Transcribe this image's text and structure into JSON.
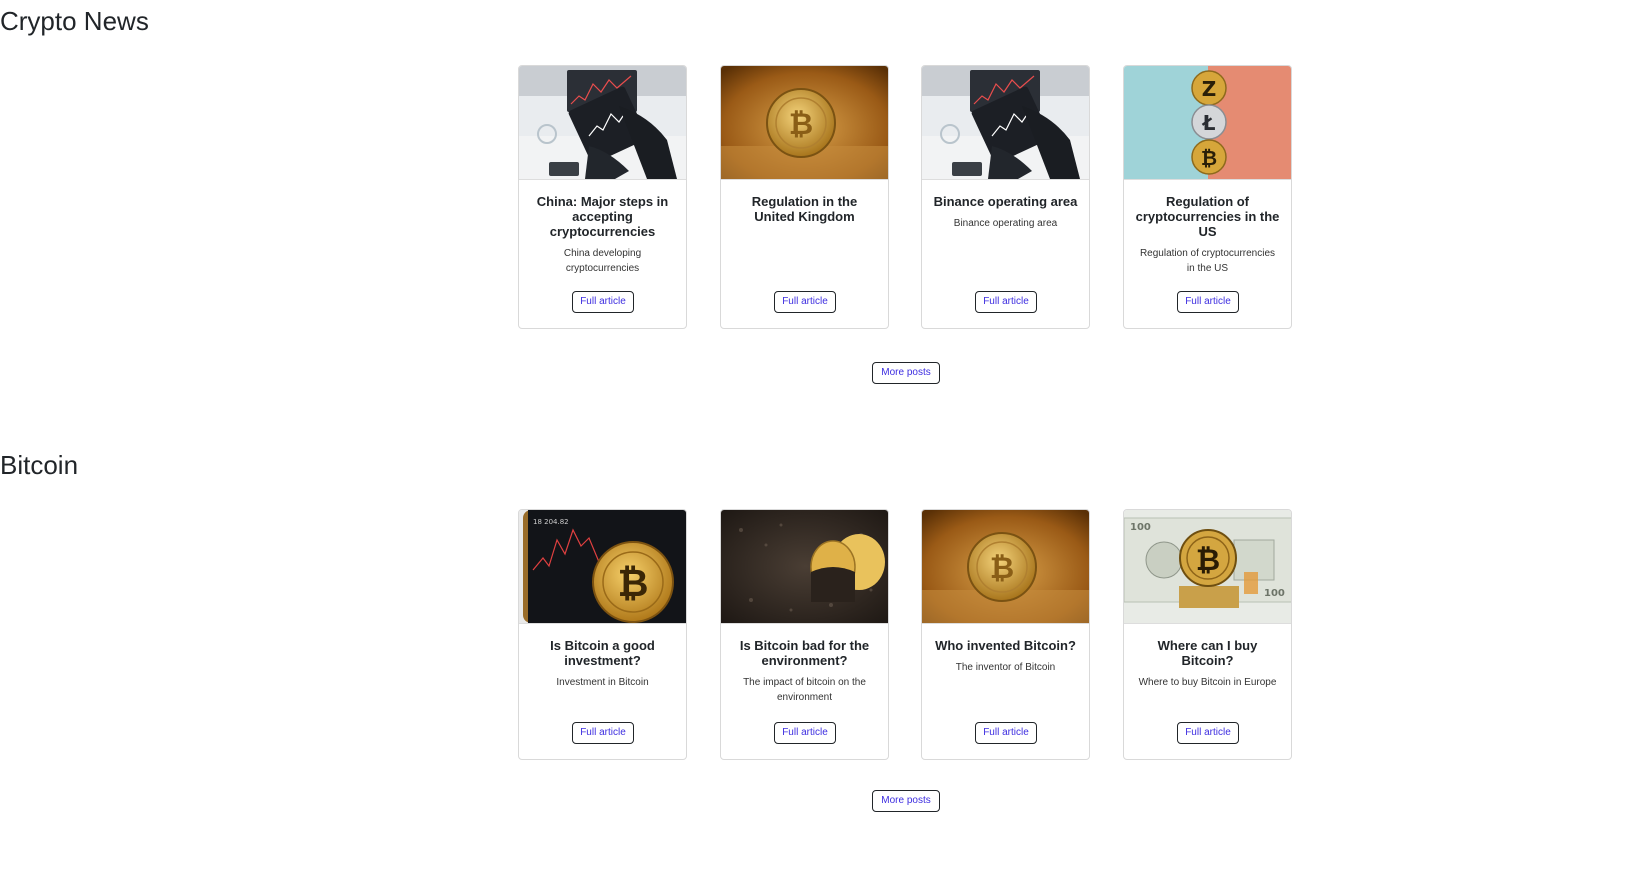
{
  "sections": [
    {
      "title": "Crypto News",
      "more_label": "More posts",
      "cards": [
        {
          "title": "China: Major steps in accepting cryptocurrencies",
          "desc": "China developing cryptocurrencies",
          "button": "Full article",
          "image": "trading-tablet-image"
        },
        {
          "title": "Regulation in the United Kingdom",
          "desc": "",
          "button": "Full article",
          "image": "bitcoin-sand-image"
        },
        {
          "title": "Binance operating area",
          "desc": "Binance operating area",
          "button": "Full article",
          "image": "trading-tablet-image"
        },
        {
          "title": "Regulation of cryptocurrencies in the US",
          "desc": "Regulation of cryptocurrencies in the US",
          "button": "Full article",
          "image": "coin-stack-image"
        }
      ]
    },
    {
      "title": "Bitcoin",
      "more_label": "More posts",
      "cards": [
        {
          "title": "Is Bitcoin a good investment?",
          "desc": "Investment in Bitcoin",
          "button": "Full article",
          "image": "bitcoin-phone-chart-image"
        },
        {
          "title": "Is Bitcoin bad for the environment?",
          "desc": "The impact of bitcoin on the environment",
          "button": "Full article",
          "image": "bitcoin-soil-image"
        },
        {
          "title": "Who invented Bitcoin?",
          "desc": "The inventor of Bitcoin",
          "button": "Full article",
          "image": "bitcoin-sand-image"
        },
        {
          "title": "Where can I buy Bitcoin?",
          "desc": "Where to buy Bitcoin in Europe",
          "button": "Full article",
          "image": "bitcoin-dollar-image"
        }
      ]
    }
  ],
  "colors": {
    "button_text": "#3d2de0",
    "button_border": "#212529",
    "card_border": "#d9d9d9",
    "heading": "#212529"
  }
}
